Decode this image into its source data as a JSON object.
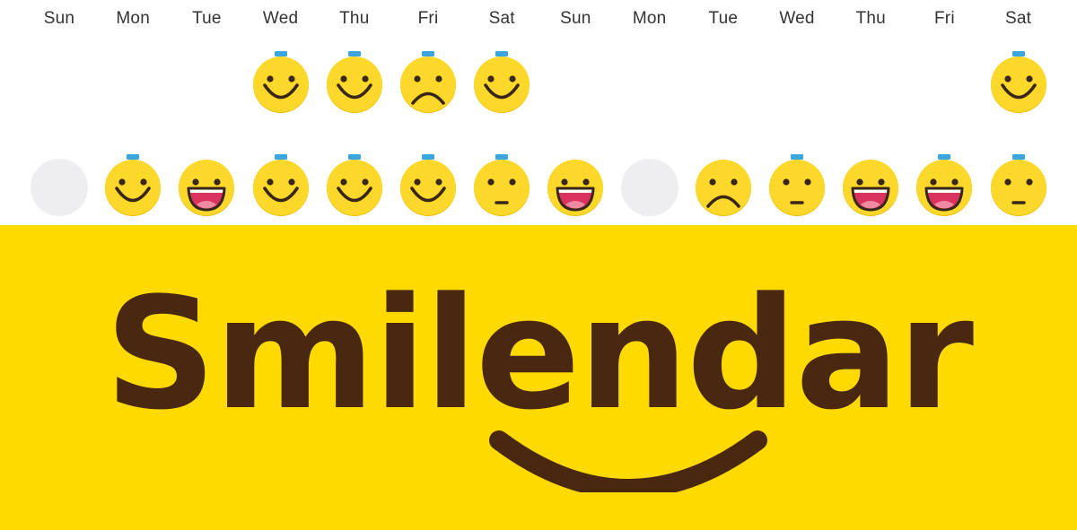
{
  "app": {
    "logo_text": "Smilendar",
    "colors": {
      "banner_bg": "#FFDA00",
      "logo_text": "#4A2810",
      "face_yellow": "#FCD82A",
      "face_shadow": "#E8BF10",
      "feature": "#3A2616",
      "mouth_fill": "#D9325E",
      "tongue": "#F08AA2",
      "marker": "#3BA5E0",
      "empty": "#EEEEF1"
    }
  },
  "calendar": {
    "day_labels": [
      "Sun",
      "Mon",
      "Tue",
      "Wed",
      "Thu",
      "Fri",
      "Sat",
      "Sun",
      "Mon",
      "Tue",
      "Wed",
      "Thu",
      "Fri",
      "Sat"
    ],
    "rows": [
      [
        "none",
        "none",
        "none",
        "smile",
        "smile",
        "sad",
        "smile",
        "none",
        "none",
        "none",
        "none",
        "none",
        "none",
        "smile"
      ],
      [
        "empty",
        "smile",
        "laugh",
        "smile",
        "smile",
        "smile",
        "neutral",
        "laugh",
        "empty",
        "sad",
        "neutral",
        "laugh",
        "laugh",
        "neutral"
      ]
    ],
    "markers": [
      [
        false,
        false,
        false,
        true,
        true,
        true,
        true,
        false,
        false,
        false,
        false,
        false,
        false,
        true
      ],
      [
        false,
        true,
        false,
        true,
        true,
        true,
        true,
        false,
        false,
        false,
        true,
        false,
        true,
        true
      ]
    ]
  }
}
